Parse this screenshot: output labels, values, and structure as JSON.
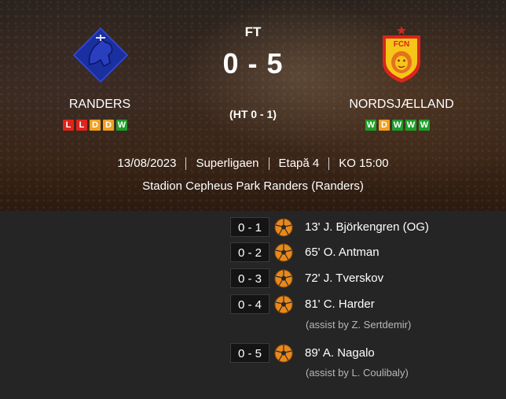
{
  "match": {
    "status": "FT",
    "score": "0 - 5",
    "halftime": "(HT 0 - 1)"
  },
  "home_team": {
    "name": "RANDERS",
    "form": [
      {
        "result": "L",
        "color": "#e0241b"
      },
      {
        "result": "L",
        "color": "#e0241b"
      },
      {
        "result": "D",
        "color": "#f0a020"
      },
      {
        "result": "D",
        "color": "#f0a020"
      },
      {
        "result": "W",
        "color": "#1e9e2a"
      }
    ]
  },
  "away_team": {
    "name": "NORDSJÆLLAND",
    "form": [
      {
        "result": "W",
        "color": "#1e9e2a"
      },
      {
        "result": "D",
        "color": "#f0a020"
      },
      {
        "result": "W",
        "color": "#1e9e2a"
      },
      {
        "result": "W",
        "color": "#1e9e2a"
      },
      {
        "result": "W",
        "color": "#1e9e2a"
      }
    ]
  },
  "info": {
    "date": "13/08/2023",
    "competition": "Superligaen",
    "round": "Etapă 4",
    "kickoff": "KO 15:00",
    "venue": "Stadion Cepheus Park Randers (Randers)"
  },
  "events": [
    {
      "score": "0 - 1",
      "text": "13' J. Björkengren (OG)",
      "assist": ""
    },
    {
      "score": "0 - 2",
      "text": "65' O. Antman",
      "assist": ""
    },
    {
      "score": "0 - 3",
      "text": "72' J. Tverskov",
      "assist": ""
    },
    {
      "score": "0 - 4",
      "text": "81' C. Harder",
      "assist": "(assist by Z. Sertdemir)"
    },
    {
      "score": "0 - 5",
      "text": "89' A. Nagalo",
      "assist": "(assist by L. Coulibaly)"
    }
  ],
  "icons": {
    "goal": "soccer-ball-icon",
    "home_logo": "randers-crest-icon",
    "away_logo": "fc-nordsjaelland-crest-icon"
  },
  "colors": {
    "ball_orange": "#e8891c",
    "ball_dark": "#2a2a2a",
    "fcn_red": "#d8261c",
    "fcn_yellow": "#f5c518",
    "randers_blue": "#1a2fa0"
  }
}
